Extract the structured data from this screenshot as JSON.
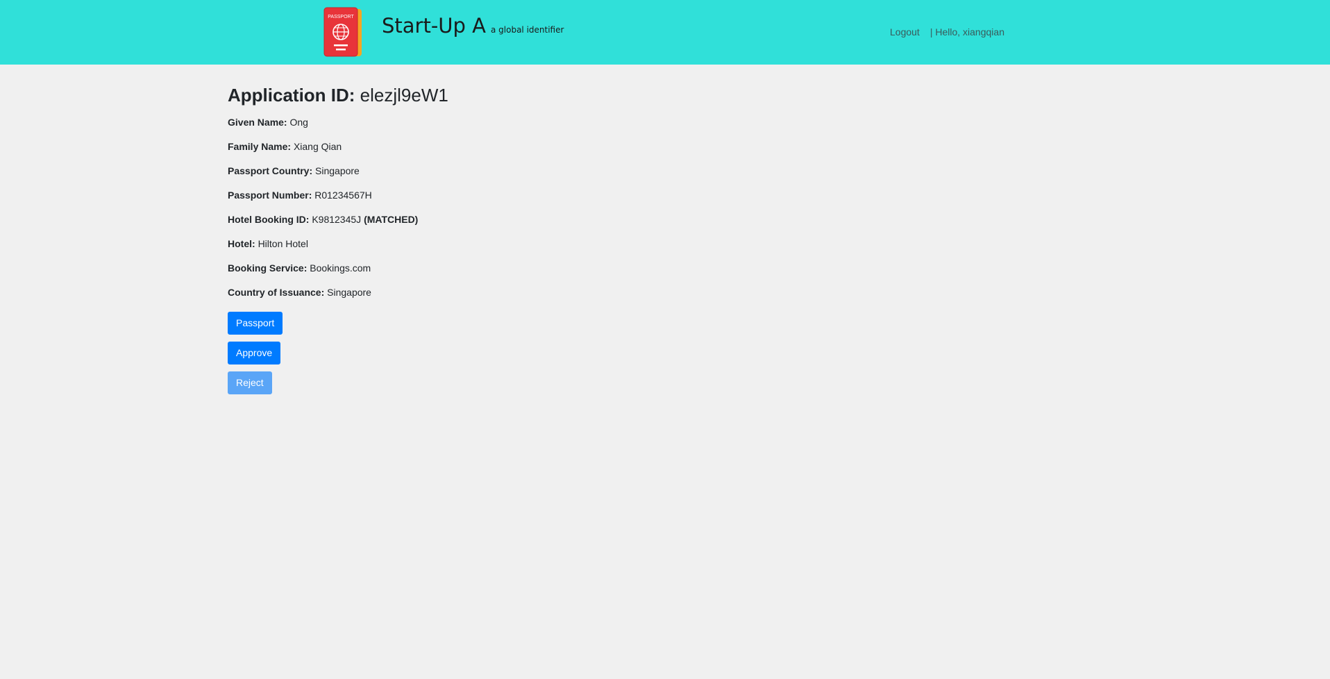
{
  "header": {
    "brand_name": "Start-Up A",
    "brand_tagline": "a global identifier",
    "logo_icon": "passport-icon",
    "logo_text": "PASSPORT",
    "logout_label": "Logout",
    "greeting": "| Hello, xiangqian",
    "bg_color": "#30e0d9"
  },
  "application": {
    "title_label": "Application ID:",
    "id": "elezjl9eW1",
    "fields": [
      {
        "label": "Given Name:",
        "value": "Ong",
        "suffix": ""
      },
      {
        "label": "Family Name:",
        "value": "Xiang Qian",
        "suffix": ""
      },
      {
        "label": "Passport Country:",
        "value": "Singapore",
        "suffix": ""
      },
      {
        "label": "Passport Number:",
        "value": "R01234567H",
        "suffix": ""
      },
      {
        "label": "Hotel Booking ID:",
        "value": "K9812345J",
        "suffix": "(MATCHED)"
      },
      {
        "label": "Hotel:",
        "value": "Hilton Hotel",
        "suffix": ""
      },
      {
        "label": "Booking Service:",
        "value": "Bookings.com",
        "suffix": ""
      },
      {
        "label": "Country of Issuance:",
        "value": "Singapore",
        "suffix": ""
      }
    ]
  },
  "actions": {
    "passport_label": "Passport",
    "approve_label": "Approve",
    "reject_label": "Reject",
    "primary_color": "#007bff"
  }
}
